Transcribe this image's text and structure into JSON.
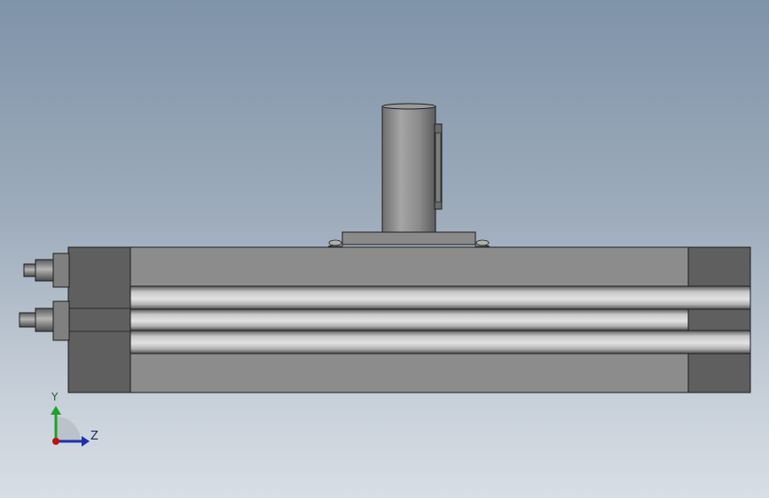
{
  "window": {
    "type": "cad-graphics-area",
    "view": "side-view",
    "background_top": "#7f93a9",
    "background_bottom": "#d8dee5"
  },
  "model": {
    "part_color": "#8c8c8c",
    "dark_color": "#5a5a5a",
    "edge_color": "#1e1e1e",
    "components": [
      "vertical-shaft",
      "mounting-flange",
      "cylinder-body",
      "left-end-cap",
      "right-end-cap",
      "fittings"
    ]
  },
  "triad": {
    "y_label": "Y",
    "z_label": "Z",
    "y_color": "#1fa02a",
    "z_color": "#1c2fb0",
    "x_color": "#c01010"
  }
}
